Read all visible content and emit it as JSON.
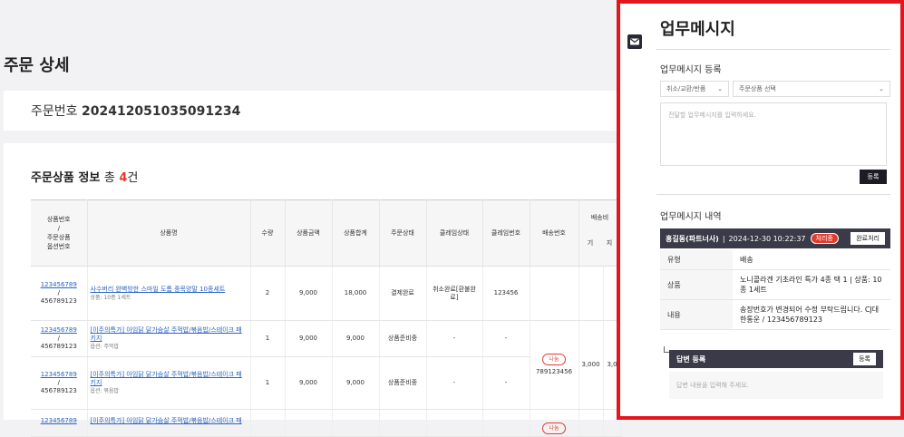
{
  "page": {
    "title": "주문 상세"
  },
  "order": {
    "label": "주문번호",
    "number": "202412051035091234"
  },
  "products_section": {
    "title": "주문상품 정보",
    "total_label": "총",
    "count": "4",
    "unit": "건"
  },
  "table": {
    "headers": {
      "code": "상품번호\n/\n주문상품\n옵션번호",
      "name": "상품명",
      "qty": "수량",
      "price": "상품금액",
      "sum": "상품합계",
      "status": "주문상태",
      "claim_status": "클레임상태",
      "claim_no": "클레임번호",
      "ship_no": "배송번호",
      "ship_fee": "배송비",
      "ship_fee_a": "기",
      "ship_fee_b": "지"
    },
    "rows": [
      {
        "code": "123456789",
        "slash": "/",
        "option": "456789123",
        "name": "사수버리 완벽방한 스마일 도톰 중목양말 10종세트",
        "sub": "상품: 10종 1세트",
        "qty": "2",
        "price": "9,000",
        "sum": "18,000",
        "status": "결제완료",
        "claim_status": "취소완료[환불완료]",
        "claim_no": "123456"
      },
      {
        "code": "123456789",
        "slash": "/",
        "option": "456789123",
        "name": "[이주의특가] 아임닭 닭가슴살 주먹밥/볶음밥/스테이크 패키지",
        "sub": "옵션: 주먹밥",
        "qty": "1",
        "price": "9,000",
        "sum": "9,000",
        "status": "상품준비중",
        "claim_status": "-",
        "claim_no": "-"
      },
      {
        "code": "123456789",
        "slash": "/",
        "option": "456789123",
        "name": "[이주의특가] 아임닭 닭가슴살 주먹밥/볶음밥/스테이크 패키지",
        "sub": "옵션: 볶음밥",
        "qty": "1",
        "price": "9,000",
        "sum": "9,000",
        "status": "상품준비중",
        "claim_status": "-",
        "claim_no": "-"
      },
      {
        "code": "123456789",
        "slash": "",
        "option": "",
        "name": "[이주의특가] 아임닭 닭가슴살 주먹밥/볶음밥/스테이크 패",
        "sub": "",
        "qty": "",
        "price": "",
        "sum": "",
        "status": "",
        "claim_status": "",
        "claim_no": ""
      }
    ],
    "shipment": {
      "badge": "나눔",
      "number": "789123456",
      "fee_a": "3,000",
      "fee_b": "3,0"
    },
    "shipment2": {
      "badge": "나눔"
    }
  },
  "panel": {
    "title": "업무메시지",
    "register_title": "업무메시지 등록",
    "category_select": "취소/교환/반품",
    "product_select": "주문상품 선택",
    "textarea_placeholder": "전달할 업무메시지를 입력하세요.",
    "register_button": "등록",
    "history_title": "업무메시지 내역",
    "message": {
      "author": "홍길동(파트너사)",
      "separator": "|",
      "datetime": "2024-12-30 10:22:37",
      "status": "처리중",
      "complete_button": "완료처리",
      "rows": [
        {
          "key": "유형",
          "value": "배송"
        },
        {
          "key": "상품",
          "value": "노니콜라겐 기초라인 특가 4종 택 1 | 상품: 10종 1세트"
        },
        {
          "key": "내용",
          "value": "송장번호가 변경되어 수정 부탁드립니다. CJ대한통운 / 123456789123"
        }
      ]
    },
    "reply": {
      "title": "답변 등록",
      "button": "등록",
      "placeholder": "답변 내용을 입력해 주세요."
    }
  },
  "colors": {
    "highlight_frame": "#e3161d",
    "accent_red": "#e23b2e",
    "dark_bar": "#3a3a48",
    "link": "#2a64c4"
  },
  "icons": {
    "mail": "mail-icon",
    "chevron": "chevron-down-icon"
  }
}
